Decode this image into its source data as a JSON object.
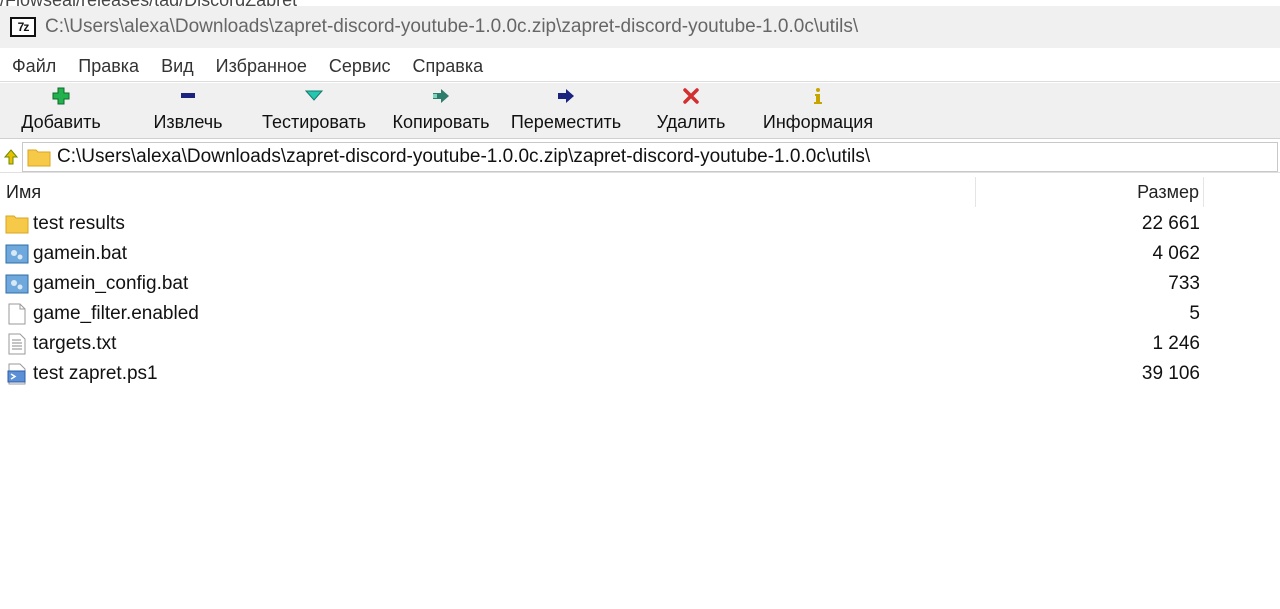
{
  "background_fragment": "/Flowseal/releases/tag/DiscordZapret",
  "window": {
    "app_icon_text": "7z",
    "title": "C:\\Users\\alexa\\Downloads\\zapret-discord-youtube-1.0.0c.zip\\zapret-discord-youtube-1.0.0c\\utils\\"
  },
  "menu": [
    "Файл",
    "Правка",
    "Вид",
    "Избранное",
    "Сервис",
    "Справка"
  ],
  "toolbar": {
    "add": "Добавить",
    "extract": "Извлечь",
    "test": "Тестировать",
    "copy": "Копировать",
    "move": "Переместить",
    "delete": "Удалить",
    "info": "Информация"
  },
  "address": {
    "path": "C:\\Users\\alexa\\Downloads\\zapret-discord-youtube-1.0.0c.zip\\zapret-discord-youtube-1.0.0c\\utils\\"
  },
  "columns": {
    "name": "Имя",
    "size": "Размер"
  },
  "files": [
    {
      "name": "test results",
      "size": "22 661",
      "icon": "folder-icon"
    },
    {
      "name": "gamein.bat",
      "size": "4 062",
      "icon": "batch-file-icon"
    },
    {
      "name": "gamein_config.bat",
      "size": "733",
      "icon": "batch-file-icon"
    },
    {
      "name": "game_filter.enabled",
      "size": "5",
      "icon": "blank-file-icon"
    },
    {
      "name": "targets.txt",
      "size": "1 246",
      "icon": "text-file-icon"
    },
    {
      "name": "test zapret.ps1",
      "size": "39 106",
      "icon": "powershell-file-icon"
    }
  ],
  "colors": {
    "add_icon": "#22b14c",
    "extract_icon": "#1a237e",
    "test_icon": "#26c6b0",
    "copy_icon": "#2e7d6b",
    "move_icon": "#1a237e",
    "delete_icon": "#d32f2f",
    "info_icon": "#c8a400",
    "folder": "#f7c948"
  }
}
